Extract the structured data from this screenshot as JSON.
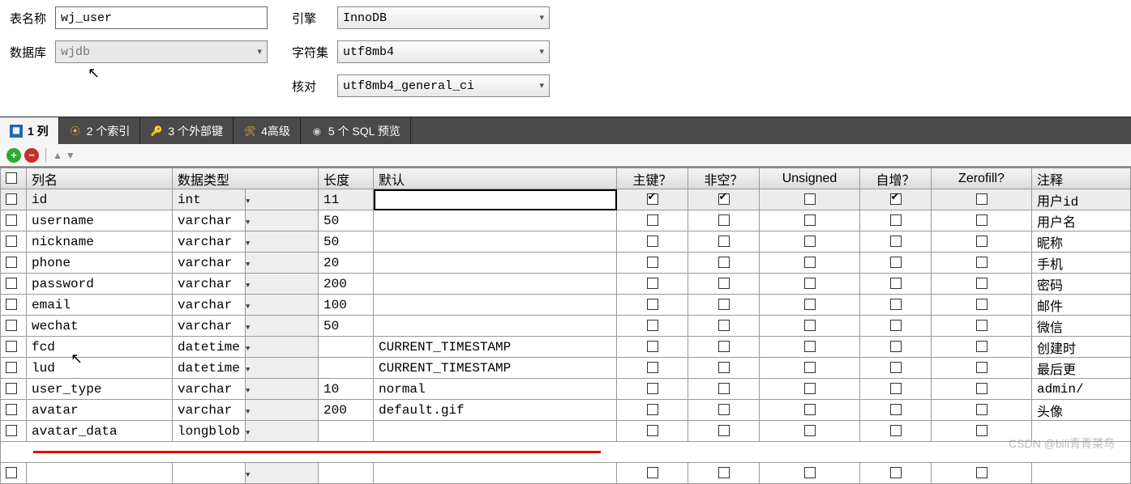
{
  "form": {
    "table_name_label": "表名称",
    "table_name_value": "wj_user",
    "database_label": "数据库",
    "database_value": "wjdb",
    "engine_label": "引擎",
    "engine_value": "InnoDB",
    "charset_label": "字符集",
    "charset_value": "utf8mb4",
    "collation_label": "核对",
    "collation_value": "utf8mb4_general_ci"
  },
  "tabs": {
    "columns": "1 列",
    "indexes": "2 个索引",
    "foreign": "3 个外部键",
    "advanced": "4高级",
    "preview": "5 个 SQL 预览"
  },
  "headers": {
    "name": "列名",
    "datatype": "数据类型",
    "length": "长度",
    "default": "默认",
    "pk": "主键？",
    "notnull": "非空？",
    "unsigned": "Unsigned",
    "autoinc": "自增？",
    "zerofill": "Zerofill?",
    "comment": "注释"
  },
  "rows": [
    {
      "name": "id",
      "type": "int",
      "len": "11",
      "def": "",
      "pk": true,
      "nn": true,
      "uns": false,
      "ai": true,
      "zf": false,
      "comment": "用户id",
      "selected": true,
      "editing": true
    },
    {
      "name": "username",
      "type": "varchar",
      "len": "50",
      "def": "",
      "pk": false,
      "nn": false,
      "uns": false,
      "ai": false,
      "zf": false,
      "comment": "用户名"
    },
    {
      "name": "nickname",
      "type": "varchar",
      "len": "50",
      "def": "",
      "pk": false,
      "nn": false,
      "uns": false,
      "ai": false,
      "zf": false,
      "comment": "昵称"
    },
    {
      "name": "phone",
      "type": "varchar",
      "len": "20",
      "def": "",
      "pk": false,
      "nn": false,
      "uns": false,
      "ai": false,
      "zf": false,
      "comment": "手机"
    },
    {
      "name": "password",
      "type": "varchar",
      "len": "200",
      "def": "",
      "pk": false,
      "nn": false,
      "uns": false,
      "ai": false,
      "zf": false,
      "comment": "密码"
    },
    {
      "name": "email",
      "type": "varchar",
      "len": "100",
      "def": "",
      "pk": false,
      "nn": false,
      "uns": false,
      "ai": false,
      "zf": false,
      "comment": "邮件"
    },
    {
      "name": "wechat",
      "type": "varchar",
      "len": "50",
      "def": "",
      "pk": false,
      "nn": false,
      "uns": false,
      "ai": false,
      "zf": false,
      "comment": "微信"
    },
    {
      "name": "fcd",
      "type": "datetime",
      "len": "",
      "def": "CURRENT_TIMESTAMP",
      "pk": false,
      "nn": false,
      "uns": false,
      "ai": false,
      "zf": false,
      "comment": "创建时"
    },
    {
      "name": "lud",
      "type": "datetime",
      "len": "",
      "def": "CURRENT_TIMESTAMP",
      "pk": false,
      "nn": false,
      "uns": false,
      "ai": false,
      "zf": false,
      "comment": "最后更"
    },
    {
      "name": "user_type",
      "type": "varchar",
      "len": "10",
      "def": "normal",
      "pk": false,
      "nn": false,
      "uns": false,
      "ai": false,
      "zf": false,
      "comment": "admin/"
    },
    {
      "name": "avatar",
      "type": "varchar",
      "len": "200",
      "def": "default.gif",
      "pk": false,
      "nn": false,
      "uns": false,
      "ai": false,
      "zf": false,
      "comment": "头像"
    },
    {
      "name": "avatar_data",
      "type": "longblob",
      "len": "",
      "def": "",
      "pk": false,
      "nn": false,
      "uns": false,
      "ai": false,
      "zf": false,
      "comment": ""
    }
  ],
  "watermark": "CSDN @bili青青菜鸟"
}
